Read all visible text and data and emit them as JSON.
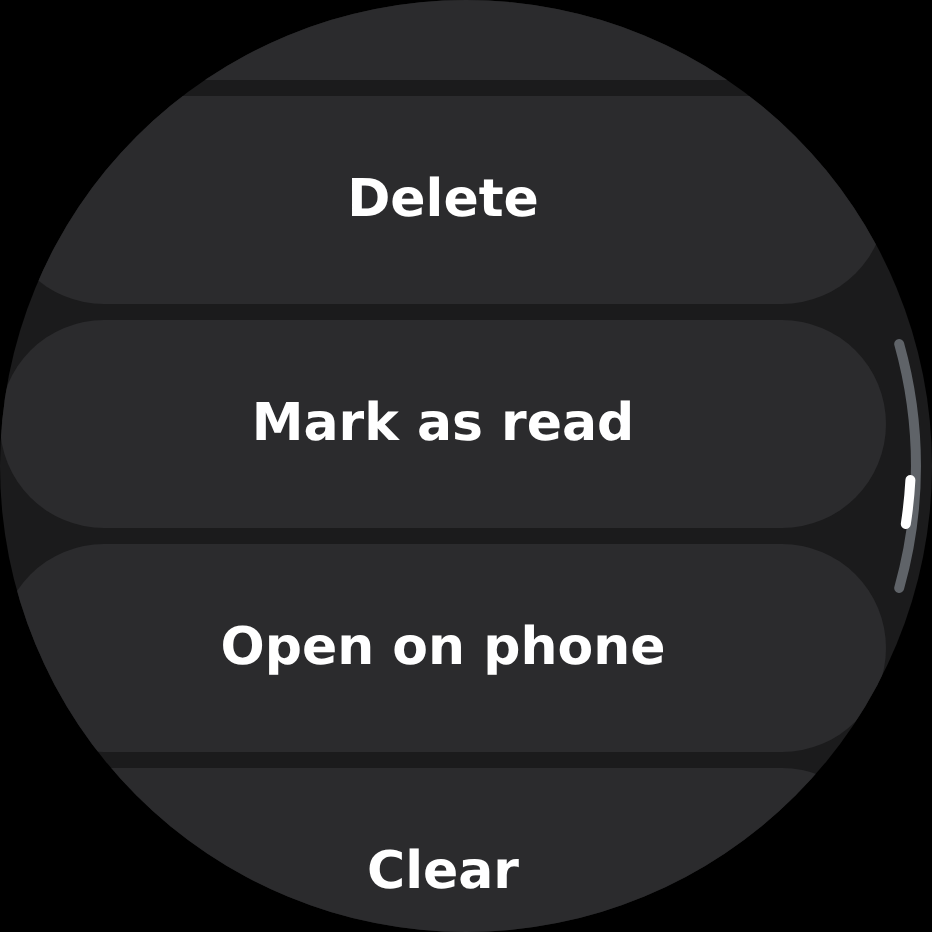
{
  "actions": [
    {
      "label": "Delete"
    },
    {
      "label": "Mark as read"
    },
    {
      "label": "Open on phone"
    },
    {
      "label": "Clear"
    }
  ]
}
